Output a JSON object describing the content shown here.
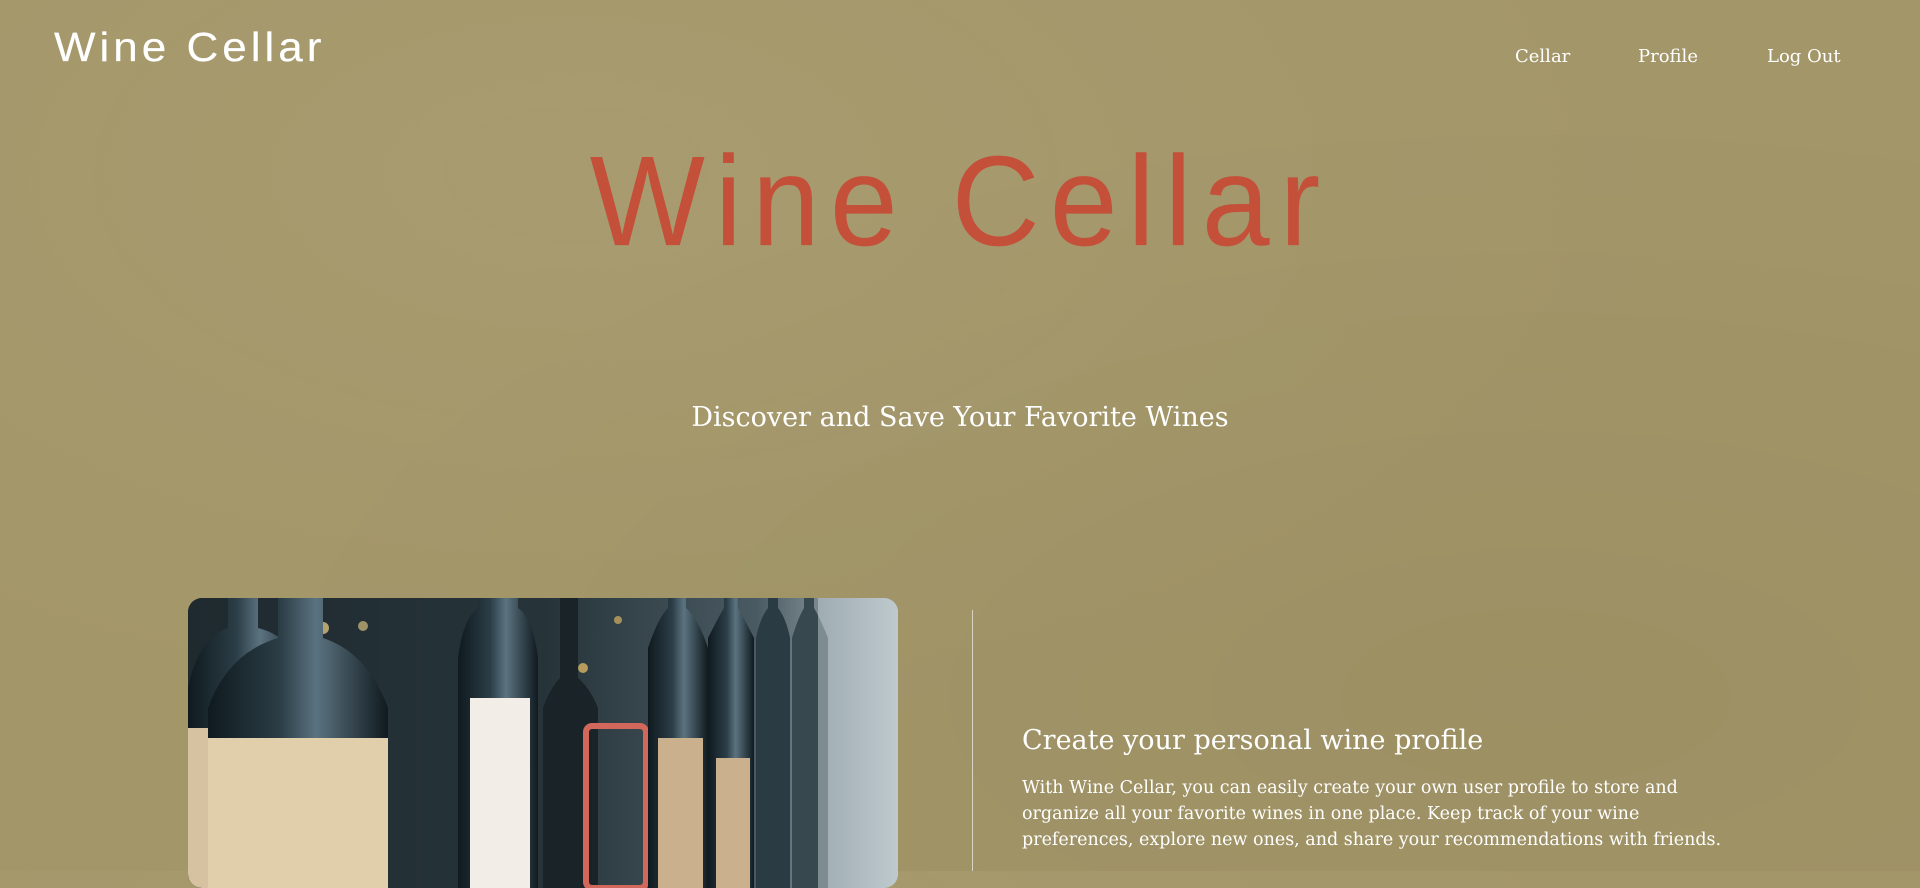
{
  "header": {
    "logo_text": "Wine Cellar",
    "nav": [
      {
        "label": "Cellar"
      },
      {
        "label": "Profile"
      },
      {
        "label": "Log Out"
      }
    ]
  },
  "hero": {
    "title": "Wine Cellar",
    "subtitle": "Discover and Save Your Favorite Wines"
  },
  "feature": {
    "image_alt": "Rows of wine bottles on a shelf",
    "heading": "Create your personal wine profile",
    "body": "With Wine Cellar, you can easily create your own user profile to store and organize all your favorite wines in one place. Keep track of your wine preferences, explore new ones, and share your recommendations with friends."
  },
  "colors": {
    "background": "#a39668",
    "accent": "#c4503a",
    "text": "#ffffff"
  }
}
